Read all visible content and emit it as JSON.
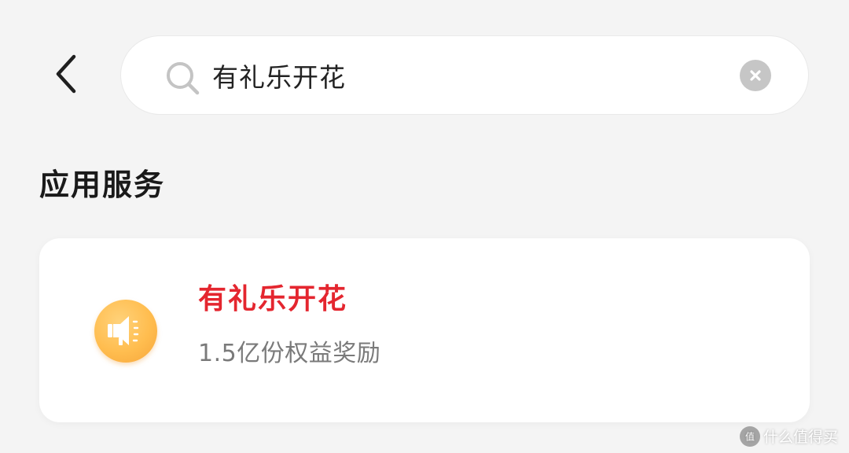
{
  "search": {
    "query": "有礼乐开花",
    "search_icon": "search-icon",
    "clear_icon": "clear-icon"
  },
  "nav": {
    "back_icon": "chevron-left-icon"
  },
  "section": {
    "title": "应用服务"
  },
  "results": [
    {
      "icon": "megaphone-icon",
      "name": "有礼乐开花",
      "description": "1.5亿份权益奖励"
    }
  ],
  "watermark": {
    "text": "什么值得买"
  },
  "colors": {
    "background": "#f4f4f4",
    "highlight": "#e4262f",
    "icon_orange": "#ffbd4f",
    "muted_text": "#7a7a7a"
  }
}
